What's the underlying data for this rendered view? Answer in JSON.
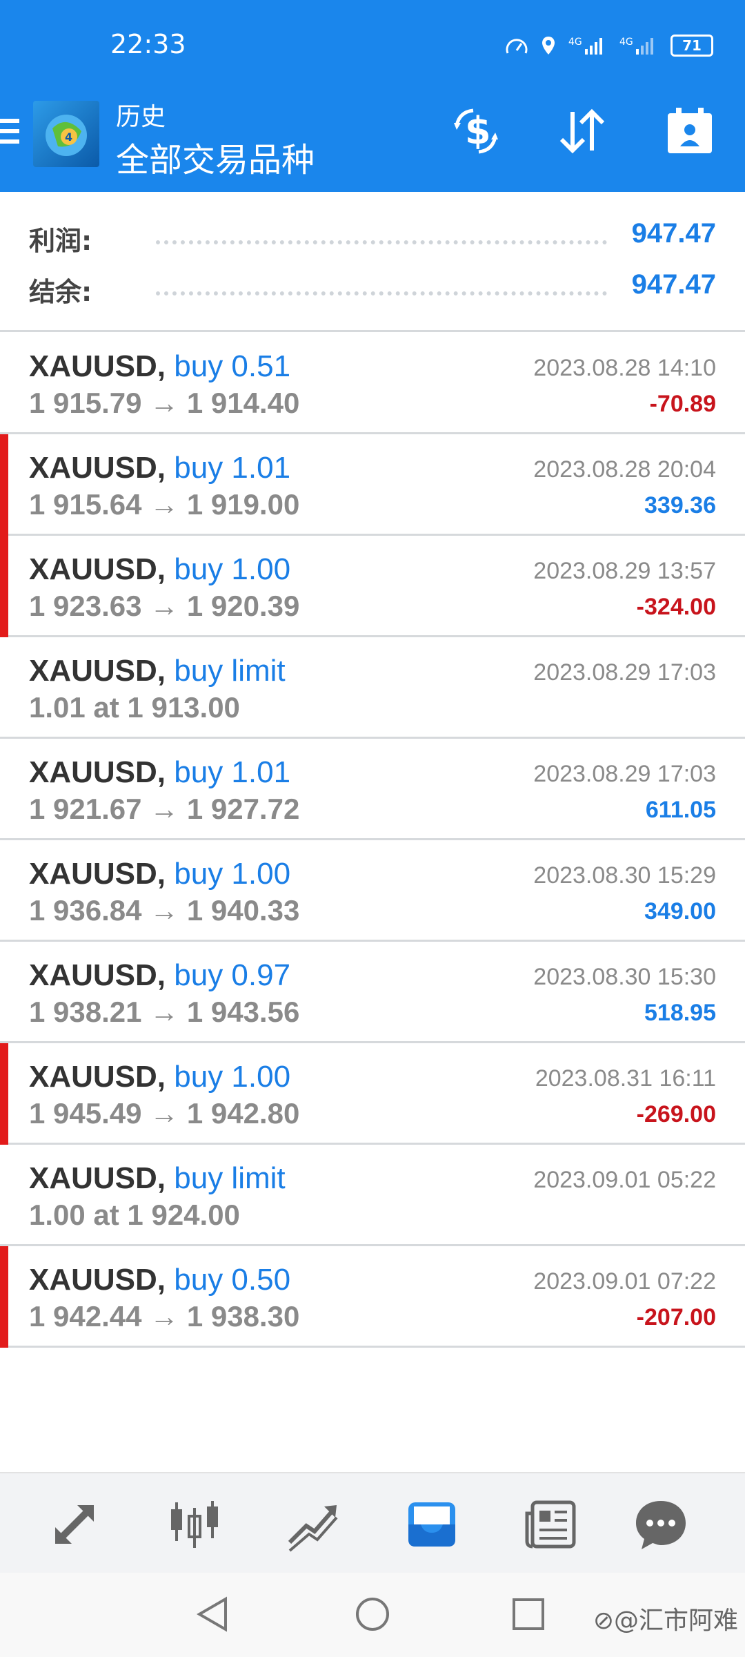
{
  "status": {
    "time": "22:33",
    "battery": "71"
  },
  "header": {
    "title_small": "历史",
    "title_big": "全部交易品种"
  },
  "summary": [
    {
      "label": "利润:",
      "value": "947.47"
    },
    {
      "label": "结余:",
      "value": "947.47"
    }
  ],
  "trades": [
    {
      "symbol": "XAUUSD",
      "side": "buy 0.51",
      "prices": "1 915.79 → 1 914.40",
      "time": "2023.08.28 14:10",
      "profit": "-70.89",
      "marked": false
    },
    {
      "symbol": "XAUUSD",
      "side": "buy 1.01",
      "prices": "1 915.64 → 1 919.00",
      "time": "2023.08.28 20:04",
      "profit": "339.36",
      "marked": true
    },
    {
      "symbol": "XAUUSD",
      "side": "buy 1.00",
      "prices": "1 923.63 → 1 920.39",
      "time": "2023.08.29 13:57",
      "profit": "-324.00",
      "marked": true
    },
    {
      "symbol": "XAUUSD",
      "side": "buy limit",
      "prices": "1.01 at 1 913.00",
      "time": "2023.08.29 17:03",
      "profit": "",
      "marked": false
    },
    {
      "symbol": "XAUUSD",
      "side": "buy 1.01",
      "prices": "1 921.67 → 1 927.72",
      "time": "2023.08.29 17:03",
      "profit": "611.05",
      "marked": false
    },
    {
      "symbol": "XAUUSD",
      "side": "buy 1.00",
      "prices": "1 936.84 → 1 940.33",
      "time": "2023.08.30 15:29",
      "profit": "349.00",
      "marked": false
    },
    {
      "symbol": "XAUUSD",
      "side": "buy 0.97",
      "prices": "1 938.21 → 1 943.56",
      "time": "2023.08.30 15:30",
      "profit": "518.95",
      "marked": false
    },
    {
      "symbol": "XAUUSD",
      "side": "buy 1.00",
      "prices": "1 945.49 → 1 942.80",
      "time": "2023.08.31 16:11",
      "profit": "-269.00",
      "marked": true
    },
    {
      "symbol": "XAUUSD",
      "side": "buy limit",
      "prices": "1.00 at 1 924.00",
      "time": "2023.09.01 05:22",
      "profit": "",
      "marked": false
    },
    {
      "symbol": "XAUUSD",
      "side": "buy 0.50",
      "prices": "1 942.44 → 1 938.30",
      "time": "2023.09.01 07:22",
      "profit": "-207.00",
      "marked": true
    }
  ],
  "nav": [
    "trade-arrows-icon",
    "candlestick-icon",
    "chart-line-icon",
    "history-inbox-icon",
    "news-icon",
    "chat-icon"
  ],
  "colors": {
    "header_bg": "#1a86ec",
    "positive": "#1a7ee6",
    "negative": "#c8141c",
    "loss_marker": "#e21b1b"
  },
  "watermark": "⊘@汇市阿难"
}
